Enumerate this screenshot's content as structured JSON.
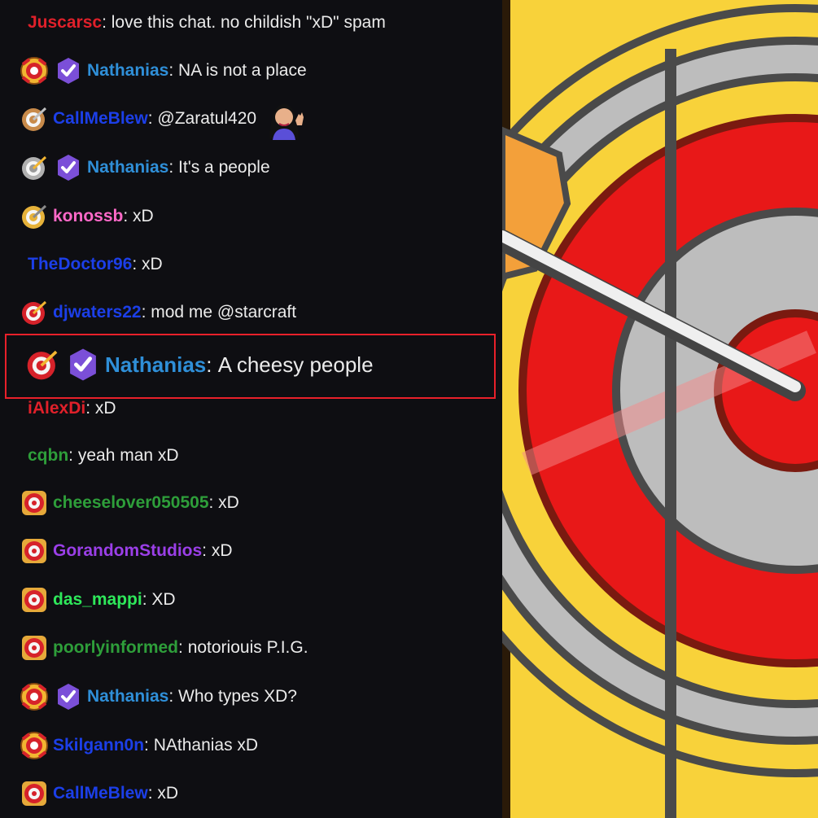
{
  "chat": {
    "messages": [
      {
        "user": "Juscarsc",
        "user_color": "#e0202a",
        "text": "love this chat. no childish \"xD\" spam",
        "badges": []
      },
      {
        "user": "Nathanias",
        "user_color": "#2f8fd8",
        "text": "NA is not a place",
        "badges": [
          "red-gold-sub-badge",
          "verified-badge"
        ]
      },
      {
        "user": "CallMeBlew",
        "user_color": "#1c3fe8",
        "text": "@Zaratul420",
        "badges": [
          "bronze-target-badge"
        ],
        "emote": "waving-woman-emote"
      },
      {
        "user": "Nathanias",
        "user_color": "#2f8fd8",
        "text": "It's a people",
        "badges": [
          "silver-target-badge",
          "verified-badge"
        ]
      },
      {
        "user": "konossb",
        "user_color": "#ff69c8",
        "text": "xD",
        "badges": [
          "gold-target-badge"
        ]
      },
      {
        "user": "TheDoctor96",
        "user_color": "#1c3fe8",
        "text": "xD",
        "badges": []
      },
      {
        "user": "djwaters22",
        "user_color": "#1c3fe8",
        "text": "mod me @starcraft",
        "badges": [
          "red-target-badge"
        ]
      },
      {
        "user": "Nathanias",
        "user_color": "#2f8fd8",
        "text": "A cheesy people",
        "badges": [
          "red-target-badge",
          "verified-badge"
        ],
        "highlighted": true
      },
      {
        "user": "iAlexDi",
        "user_color": "#e0202a",
        "text": "xD",
        "badges": []
      },
      {
        "user": "cqbn",
        "user_color": "#2e9e3a",
        "text": "yeah man xD",
        "badges": []
      },
      {
        "user": "cheeselover050505",
        "user_color": "#2e9e3a",
        "text": "xD",
        "badges": [
          "gold-frame-target-badge"
        ]
      },
      {
        "user": "GorandomStudios",
        "user_color": "#9b3fe8",
        "text": "xD",
        "badges": [
          "gold-frame-target-badge"
        ]
      },
      {
        "user": "das_mappi",
        "user_color": "#2ee85a",
        "text": "XD",
        "badges": [
          "gold-frame-target-badge"
        ]
      },
      {
        "user": "poorlyinformed",
        "user_color": "#2e9e3a",
        "text": "notoriouis P.I.G.",
        "badges": [
          "gold-frame-target-badge"
        ]
      },
      {
        "user": "Nathanias",
        "user_color": "#2f8fd8",
        "text": "Who types XD?",
        "badges": [
          "red-gold-sub-badge",
          "verified-badge"
        ]
      },
      {
        "user": "Skilgann0n",
        "user_color": "#1c3fe8",
        "text": "NAthanias xD",
        "badges": [
          "red-gold-sub-badge"
        ]
      },
      {
        "user": "CallMeBlew",
        "user_color": "#1c3fe8",
        "text": "xD",
        "badges": [
          "gold-frame-target-badge"
        ]
      }
    ]
  },
  "art": {
    "name": "target-dartboard-art",
    "colors": {
      "yellow": "#f8d23a",
      "red": "#e81818",
      "gray": "#b4b4b4",
      "outline": "#4a4a4a"
    }
  }
}
